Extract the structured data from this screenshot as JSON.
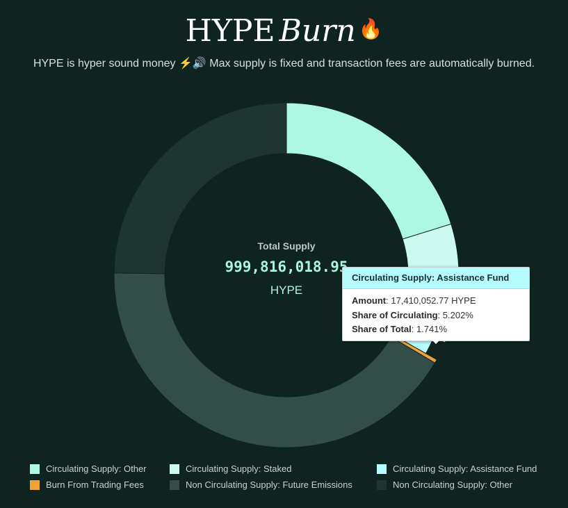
{
  "header": {
    "title_main": "HYPE",
    "title_italic": "Burn",
    "title_emoji": "🔥",
    "subtitle": "HYPE is hyper sound money ⚡🔊 Max supply is fixed and transaction fees are automatically burned."
  },
  "colors": {
    "background": "#0f2421",
    "circ_other": "#aef8e2",
    "circ_staked": "#ccfaf0",
    "circ_assist": "#b6fbff",
    "burn": "#f0a13a",
    "noncirc_future": "#334e48",
    "noncirc_other": "#1e3531"
  },
  "chart_data": {
    "type": "pie",
    "donut": true,
    "center": {
      "caption": "Total Supply",
      "value": "999,816,018.95",
      "unit": "HYPE"
    },
    "slices": [
      {
        "name": "Circulating Supply: Other",
        "value": 20.2,
        "color": "#aef8e2"
      },
      {
        "name": "Circulating Supply: Staked",
        "value": 11.2,
        "color": "#ccfaf0"
      },
      {
        "name": "Circulating Supply: Assistance Fund",
        "value": 1.741,
        "color": "#b6fbff"
      },
      {
        "name": "Burn From Trading Fees",
        "value": 0.35,
        "color": "#f0a13a"
      },
      {
        "name": "Non Circulating Supply: Future Emissions",
        "value": 41.7,
        "color": "#334e48"
      },
      {
        "name": "Non Circulating Supply: Other",
        "value": 24.8,
        "color": "#1e3531"
      }
    ],
    "legend_position": "bottom"
  },
  "tooltip": {
    "title": "Circulating Supply: Assistance Fund",
    "rows": [
      {
        "label": "Amount",
        "value": "17,410,052.77 HYPE"
      },
      {
        "label": "Share of Circulating",
        "value": "5.202%"
      },
      {
        "label": "Share of Total",
        "value": "1.741%"
      }
    ]
  }
}
